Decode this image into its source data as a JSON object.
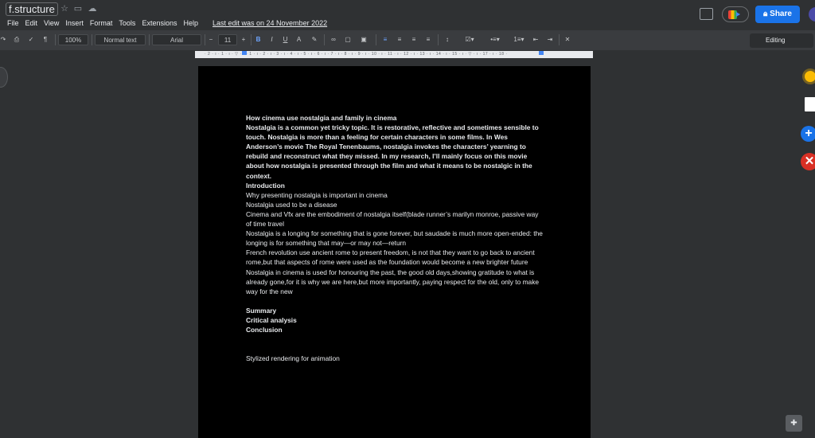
{
  "header": {
    "doc_title": "f.structure",
    "last_edit": "Last edit was on 24 November 2022",
    "share_label": "Share",
    "editing_label": "Editing"
  },
  "menu": [
    "File",
    "Edit",
    "View",
    "Insert",
    "Format",
    "Tools",
    "Extensions",
    "Help"
  ],
  "toolbar": {
    "zoom": "100%",
    "style": "Normal text",
    "font": "Arial",
    "font_size": "11",
    "minus": "−",
    "plus": "+",
    "bold": "B",
    "italic": "I",
    "underline": "U",
    "text_color": "A"
  },
  "ruler": {
    "text": "· 2 · ı · 1 · ı · ▽ · ı · 1 · ı · 2 · ı · 3 · ı · 4 · ı · 5 · ı · 6 · ı · 7 · ı · 8 · ı · 9 · ı · 10 · ı · 11 · ı · 12 · ı · 13 · ı · 14 · ı · 15 · ı · ▽ · ı · 17 · ı · 18 ·"
  },
  "document": {
    "heading": "How cinema use nostalgia and family in cinema",
    "intro_paragraph": "Nostalgia is a common yet tricky topic. It is restorative, reflective and sometimes sensible to touch. Nostalgia is more than a feeling for certain characters in some films. In Wes Anderson’s movie The Royal Tenenbaums, nostalgia invokes the characters’ yearning to rebuild and reconstruct what they missed. In my research, I’ll mainly focus on this movie about how nostalgia is presented through the film and what it means to be nostalgic in the context.",
    "introduction_label": "Introduction",
    "lines": [
      "Why presenting nostalgia is important in cinema",
      "Nostalgia used to be a disease",
      "Cinema and Vfx are the embodiment of nostalgia itself(blade runner’s marilyn monroe, passive way of time travel",
      "Nostalgia is a longing for something that is gone forever, but saudade is much more open-ended: the longing is for something that may—or may not—return",
      "French revolution use ancient rome to present freedom, is not that they want to go back to ancient rome,but that aspects of rome were used as the foundation would become a new brighter future",
      "Nostalgia in cinema is used for honouring the past, the good old days,showing gratitude to what is already gone,for it is why we are here,but more importantly, paying respect for the old, only to make way for the new"
    ],
    "summary_label": "Summary",
    "critical_label": "Critical analysis",
    "conclusion_label": "Conclusion",
    "footer_line": "Stylized rendering for animation"
  }
}
